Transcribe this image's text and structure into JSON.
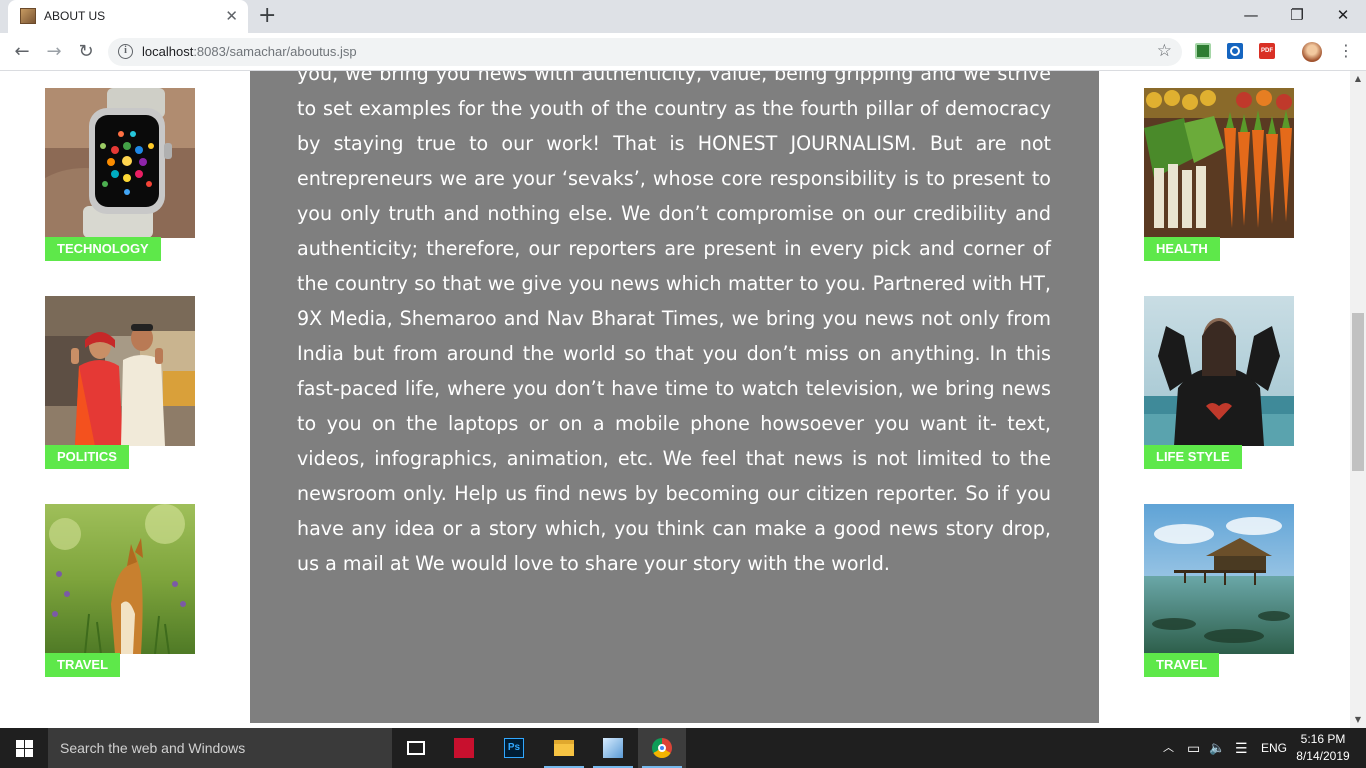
{
  "browser": {
    "tab_title": "ABOUT US",
    "close_glyph": "✕",
    "new_tab_glyph": "+",
    "url_host": "localhost",
    "url_rest": ":8083/samachar/aboutus.jsp",
    "back_glyph": "←",
    "forward_glyph": "→",
    "reload_glyph": "↻",
    "star_glyph": "☆",
    "info_glyph": "i",
    "menu_glyph": "⋮",
    "pdf_label": "PDF",
    "window": {
      "minimize": "—",
      "restore": "❐",
      "close": "✕"
    }
  },
  "left_cards": [
    {
      "label": "TECHNOLOGY",
      "image": "smartwatch-image"
    },
    {
      "label": "POLITICS",
      "image": "couple-voting-image"
    },
    {
      "label": "TRAVEL",
      "image": "fox-in-meadow-image"
    }
  ],
  "right_cards": [
    {
      "label": "HEALTH",
      "image": "vegetables-image"
    },
    {
      "label": "LIFE STYLE",
      "image": "woman-at-sea-image"
    },
    {
      "label": "TRAVEL",
      "image": "water-hut-image"
    }
  ],
  "article": {
    "text": "you, we bring you news with authenticity, value, being gripping and we strive to set examples for the youth of the country as the fourth pillar of democracy by staying true to our work! That is HONEST JOURNALISM. But are not entrepreneurs we are your ‘sevaks’, whose core responsibility is to present to you only truth and nothing else. We don’t compromise on our credibility and authenticity; therefore, our reporters are present in every pick and corner of the country so that we give you news which matter to you. Partnered with HT, 9X Media, Shemaroo and Nav Bharat Times, we bring you news not only from India but from around the world so that you don’t miss on anything. In this fast-paced life, where you don’t have time to watch television, we bring news to you on the laptops or on a mobile phone howsoever you want it- text, videos, infographics, animation, etc. We feel that news is not limited to the newsroom only. Help us find news by becoming our citizen reporter. So if you have any idea or a story which, you think can make a good news story drop, us a mail at We would love to share your story with the world."
  },
  "scrollbar": {
    "up_glyph": "▲",
    "down_glyph": "▼",
    "position_fraction": 0.42
  },
  "taskbar": {
    "search_placeholder": "Search the web and Windows",
    "apps": [
      "task-view",
      "adobe-reader",
      "photoshop",
      "file-explorer",
      "3d-box-app",
      "chrome"
    ],
    "ps_label": "Ps",
    "tray_chevron": "︿",
    "battery_glyph": "▭",
    "volume_glyph": "🔈",
    "message_glyph": "☰",
    "language": "ENG",
    "time": "5:16 PM",
    "date": "8/14/2019"
  },
  "colors": {
    "label_green": "#5ee84a",
    "article_bg": "#7f7f7f",
    "taskbar_bg": "#1f1f1f",
    "tabstrip_bg": "#dee1e6"
  }
}
